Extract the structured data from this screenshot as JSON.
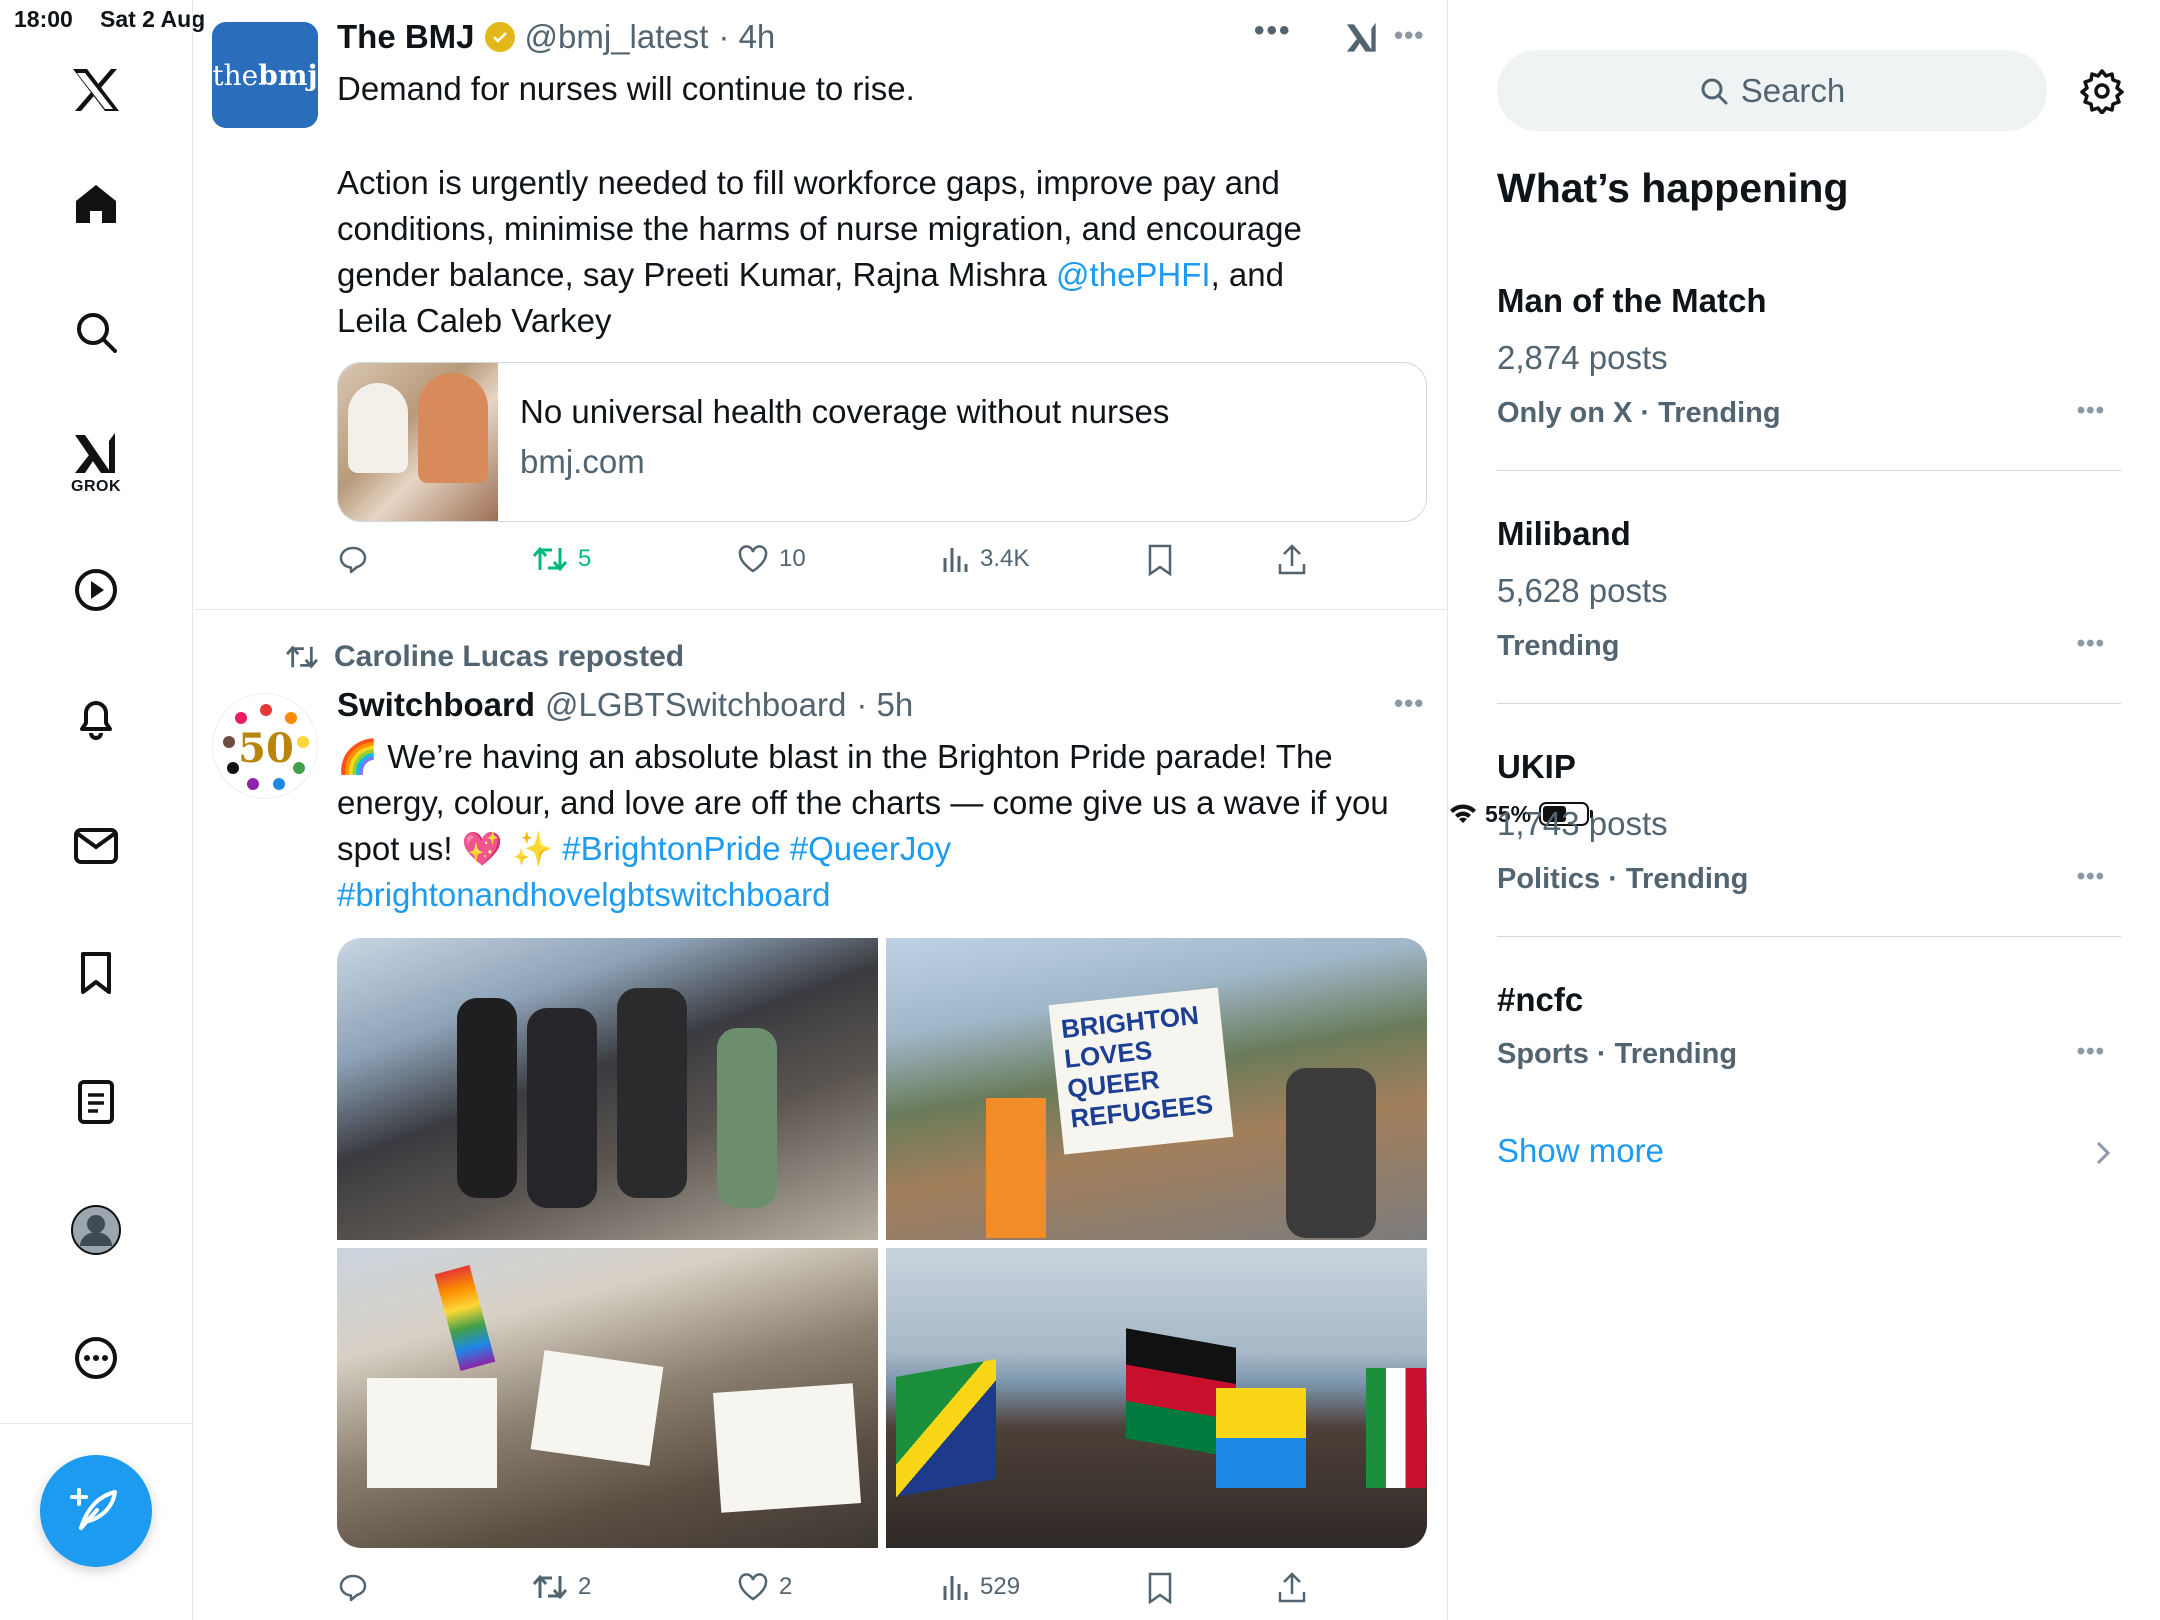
{
  "status": {
    "time": "18:00",
    "date": "Sat 2 Aug",
    "battery": "55%",
    "battery_level": 0.55
  },
  "nav": {
    "grok_label": "GROK",
    "items": [
      "x-logo",
      "home-icon",
      "search-icon",
      "grok-icon",
      "video-icon",
      "notifications-icon",
      "messages-icon",
      "bookmarks-icon",
      "lists-icon",
      "profile-icon",
      "more-icon"
    ]
  },
  "tweets": [
    {
      "avatar_text_light": "the",
      "avatar_text_bold": "bmj",
      "name": "The BMJ",
      "handle": "@bmj_latest",
      "time": "· 4h",
      "line1": "Demand for nurses will continue to rise.",
      "body_a": "Action is urgently needed to fill workforce gaps, improve pay and conditions, minimise the harms of nurse migration, and encourage gender balance, say Preeti Kumar, Rajna Mishra ",
      "mention": "@thePHFI",
      "body_b": ", and Leila Caleb Varkey",
      "card_title": "No universal health coverage without nurses",
      "card_domain": "bmj.com",
      "reposts": "5",
      "likes": "10",
      "views": "3.4K"
    },
    {
      "repost_label": "Caroline Lucas reposted",
      "avatar_text": "50",
      "name": "Switchboard",
      "handle": "@LGBTSwitchboard",
      "time": "· 5h",
      "emoji_rainbow": "🌈",
      "text1": " We’re having an absolute blast in the Brighton Pride parade! The energy, colour, and love are off the charts — come give us a wave if you spot us! ",
      "emoji_heart": "💖 ✨",
      "hashtag1": " #BrightonPride",
      "hashtag2": " #QueerJoy",
      "hashtag3": "#brightonandhovelgbtswitchboard",
      "sign_text": "BRIGHTON LOVES QUEER REFUGEES",
      "reposts": "2",
      "likes": "2",
      "views": "529"
    }
  ],
  "right": {
    "search_placeholder": "Search",
    "title": "What’s happening",
    "trends": [
      {
        "name": "Man of the Match",
        "count": "2,874 posts",
        "meta": "Only on X · Trending"
      },
      {
        "name": "Miliband",
        "count": "5,628 posts",
        "meta": "Trending"
      },
      {
        "name": "UKIP",
        "count": "1,743 posts",
        "meta": "Politics · Trending"
      },
      {
        "name": "#ncfc",
        "count": "",
        "meta": "Sports · Trending"
      }
    ],
    "show_more": "Show more"
  },
  "colors": {
    "accent": "#1d9bf0",
    "repost_active": "#00ba7c",
    "muted": "#536471"
  }
}
